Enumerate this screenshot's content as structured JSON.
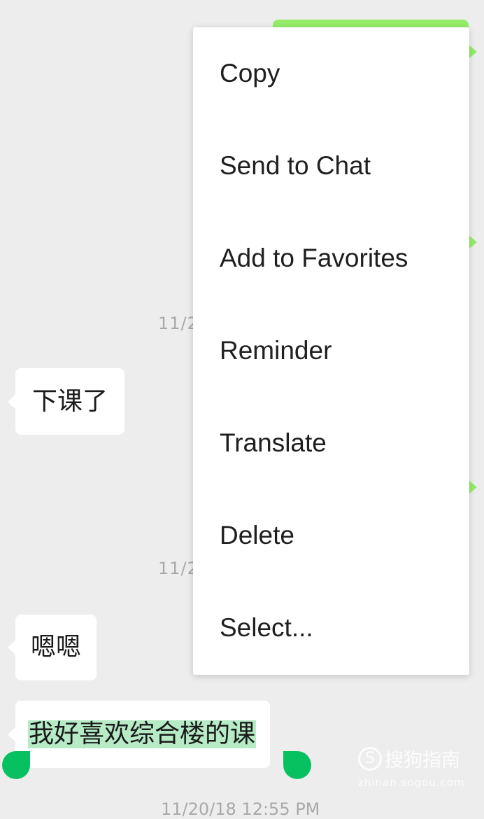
{
  "context_menu": {
    "items": [
      {
        "label": "Copy"
      },
      {
        "label": "Send to Chat"
      },
      {
        "label": "Add to Favorites"
      },
      {
        "label": "Reminder"
      },
      {
        "label": "Translate"
      },
      {
        "label": "Delete"
      },
      {
        "label": "Select..."
      }
    ]
  },
  "chat": {
    "timestamps": [
      "11/2",
      "11/2"
    ],
    "messages": [
      {
        "sender": "other",
        "text": "下课了"
      },
      {
        "sender": "other",
        "text": "嗯嗯"
      },
      {
        "sender": "other",
        "text": "我好喜欢综合楼的课",
        "selected": true
      }
    ],
    "bottom_timestamp_partial": "11/20/18 12:55 PM"
  },
  "watermark": {
    "logo_text": "搜狗指南",
    "url": "zhinan.sogou.com"
  },
  "colors": {
    "background": "#ededed",
    "bubble_outgoing": "#95ec69",
    "bubble_incoming": "#ffffff",
    "selection_highlight": "#b6ebc6",
    "selection_handle": "#07c160"
  }
}
